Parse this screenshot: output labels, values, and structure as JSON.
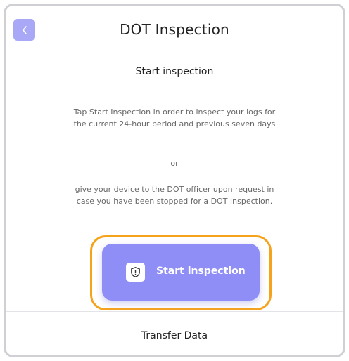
{
  "header": {
    "title": "DOT Inspection",
    "back_icon": "chevron-left-icon"
  },
  "main": {
    "subtitle": "Start inspection",
    "description_1": "Tap Start Inspection in order to inspect your logs for the current 24-hour period and previous seven days",
    "separator": "or",
    "description_2": "give your device to the DOT officer upon request in case you have been stopped for a DOT Inspection.",
    "start_button": {
      "label": "Start inspection",
      "icon": "shield-alert-icon"
    }
  },
  "footer": {
    "transfer_label": "Transfer Data"
  },
  "colors": {
    "accent": "#8f8ef7",
    "back_button": "#a9a8f6",
    "highlight": "#f6a31c"
  }
}
